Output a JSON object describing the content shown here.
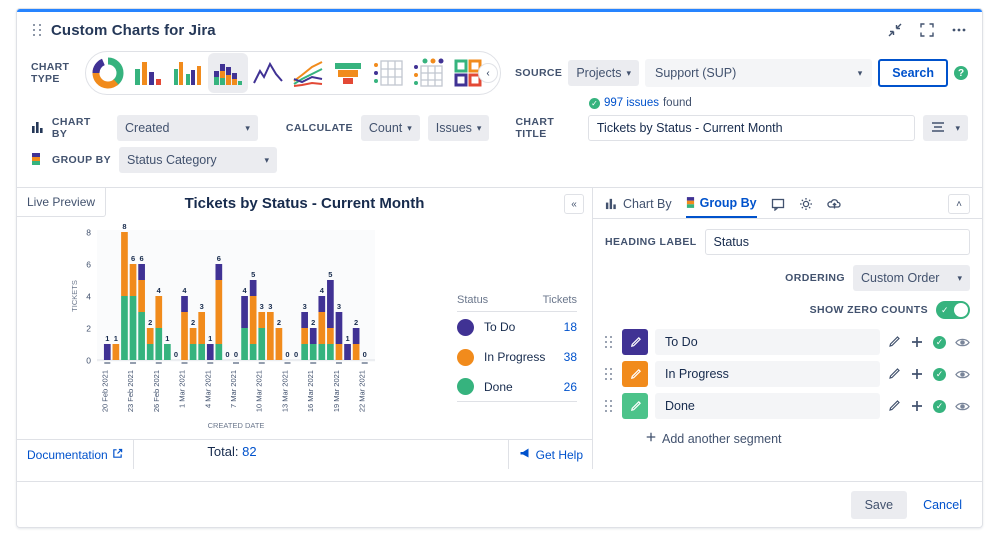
{
  "window": {
    "title": "Custom Charts for Jira",
    "title_actions": [
      {
        "name": "collapse-icon",
        "label": "collapse"
      },
      {
        "name": "fullscreen-icon",
        "label": "fullscreen"
      },
      {
        "name": "more-options-icon",
        "label": "…"
      }
    ]
  },
  "chart_type": {
    "label_line1": "CHART",
    "label_line2": "TYPE",
    "items": [
      {
        "name": "donut-chart-type",
        "selected": false
      },
      {
        "name": "bar-chart-type",
        "selected": false
      },
      {
        "name": "grouped-bar-chart-type",
        "selected": false
      },
      {
        "name": "stacked-bar-chart-type",
        "selected": true
      },
      {
        "name": "area-chart-type",
        "selected": false
      },
      {
        "name": "line-chart-type",
        "selected": false
      },
      {
        "name": "funnel-chart-type",
        "selected": false
      },
      {
        "name": "table-chart-type",
        "selected": false
      },
      {
        "name": "bubble-table-chart-type",
        "selected": false
      },
      {
        "name": "tile-chart-type",
        "selected": false
      }
    ],
    "collapse_label": "‹"
  },
  "source": {
    "label": "SOURCE",
    "kind": "Projects",
    "value": "Support (SUP)",
    "search_label": "Search",
    "help_label": "?",
    "issues_count": "997 issues",
    "issues_suffix": "found"
  },
  "config": {
    "chart_by_label": "CHART BY",
    "chart_by_value": "Created",
    "group_by_label": "GROUP BY",
    "group_by_value": "Status Category",
    "calculate_label": "CALCULATE",
    "calculate_value": "Count",
    "calculate_unit": "Issues",
    "chart_title_label": "CHART TITLE",
    "chart_title_value": "Tickets by Status - Current Month"
  },
  "preview": {
    "tab_label": "Live Preview",
    "collapse_label": "«",
    "total_label": "Total:",
    "total_value": "82",
    "documentation_label": "Documentation",
    "get_help_label": "Get Help"
  },
  "chart_data": {
    "type": "bar",
    "title": "Tickets by Status - Current Month",
    "xlabel": "CREATED DATE",
    "ylabel": "TICKETS",
    "ylim": [
      0,
      8
    ],
    "yticks": [
      0,
      2,
      4,
      6,
      8
    ],
    "grid": false,
    "stacked": true,
    "legend_position": "right",
    "tick_labels": [
      "20 Feb 2021",
      "23 Feb 2021",
      "26 Feb 2021",
      "1 Mar 2021",
      "4 Mar 2021",
      "7 Mar 2021",
      "10 Mar 2021",
      "13 Mar 2021",
      "16 Mar 2021",
      "19 Mar 2021",
      "22 Mar 2021"
    ],
    "series": [
      {
        "name": "To Do",
        "color": "#403294",
        "total": 18
      },
      {
        "name": "In Progress",
        "color": "#F18B1C",
        "total": 38
      },
      {
        "name": "Done",
        "color": "#36B37E",
        "total": 26
      }
    ],
    "bars": [
      {
        "total": 1,
        "todo": 1,
        "inprogress": 0,
        "done": 0
      },
      {
        "total": 1,
        "todo": 0,
        "inprogress": 1,
        "done": 0
      },
      {
        "total": 8,
        "todo": 0,
        "inprogress": 4,
        "done": 4
      },
      {
        "total": 6,
        "todo": 0,
        "inprogress": 2,
        "done": 4
      },
      {
        "total": 6,
        "todo": 1,
        "inprogress": 2,
        "done": 3
      },
      {
        "total": 2,
        "todo": 0,
        "inprogress": 1,
        "done": 1
      },
      {
        "total": 4,
        "todo": 0,
        "inprogress": 2,
        "done": 2
      },
      {
        "total": 1,
        "todo": 0,
        "inprogress": 0,
        "done": 1
      },
      {
        "total": 0,
        "todo": 0,
        "inprogress": 0,
        "done": 0
      },
      {
        "total": 4,
        "todo": 1,
        "inprogress": 3,
        "done": 0
      },
      {
        "total": 2,
        "todo": 0,
        "inprogress": 1,
        "done": 1
      },
      {
        "total": 3,
        "todo": 0,
        "inprogress": 2,
        "done": 1
      },
      {
        "total": 1,
        "todo": 1,
        "inprogress": 0,
        "done": 0
      },
      {
        "total": 6,
        "todo": 1,
        "inprogress": 4,
        "done": 1
      },
      {
        "total": 0,
        "todo": 0,
        "inprogress": 0,
        "done": 0
      },
      {
        "total": 0,
        "todo": 0,
        "inprogress": 0,
        "done": 0
      },
      {
        "total": 4,
        "todo": 2,
        "inprogress": 0,
        "done": 2
      },
      {
        "total": 5,
        "todo": 1,
        "inprogress": 3,
        "done": 1
      },
      {
        "total": 3,
        "todo": 0,
        "inprogress": 1,
        "done": 2
      },
      {
        "total": 3,
        "todo": 0,
        "inprogress": 3,
        "done": 0
      },
      {
        "total": 2,
        "todo": 0,
        "inprogress": 2,
        "done": 0
      },
      {
        "total": 0,
        "todo": 0,
        "inprogress": 0,
        "done": 0
      },
      {
        "total": 0,
        "todo": 0,
        "inprogress": 0,
        "done": 0
      },
      {
        "total": 3,
        "todo": 1,
        "inprogress": 1,
        "done": 1
      },
      {
        "total": 2,
        "todo": 1,
        "inprogress": 0,
        "done": 1
      },
      {
        "total": 4,
        "todo": 1,
        "inprogress": 2,
        "done": 1
      },
      {
        "total": 5,
        "todo": 3,
        "inprogress": 1,
        "done": 1
      },
      {
        "total": 3,
        "todo": 2,
        "inprogress": 1,
        "done": 0
      },
      {
        "total": 1,
        "todo": 1,
        "inprogress": 0,
        "done": 0
      },
      {
        "total": 2,
        "todo": 1,
        "inprogress": 1,
        "done": 0
      },
      {
        "total": 0,
        "todo": 0,
        "inprogress": 0,
        "done": 0
      }
    ]
  },
  "legend": {
    "col_status": "Status",
    "col_tickets": "Tickets",
    "rows": [
      {
        "name": "To Do",
        "value": "18",
        "color": "#403294"
      },
      {
        "name": "In Progress",
        "value": "38",
        "color": "#F18B1C"
      },
      {
        "name": "Done",
        "value": "26",
        "color": "#36B37E"
      }
    ]
  },
  "right_panel": {
    "tabs": [
      {
        "label": "Chart By",
        "icon": "bar-chart-icon",
        "active": false
      },
      {
        "label": "Group By",
        "icon": "stacked-color-icon",
        "active": true
      },
      {
        "label": "",
        "icon": "comment-icon",
        "active": false
      },
      {
        "label": "",
        "icon": "gear-icon",
        "active": false
      },
      {
        "label": "",
        "icon": "cloud-upload-icon",
        "active": false
      }
    ],
    "expand_label": "˄",
    "heading_label": "HEADING LABEL",
    "heading_value": "Status",
    "ordering_label": "ORDERING",
    "ordering_value": "Custom Order",
    "show_zero_counts_label": "SHOW ZERO COUNTS",
    "show_zero_counts_on": true,
    "segments": [
      {
        "name": "To Do",
        "color": "#403294"
      },
      {
        "name": "In Progress",
        "color": "#F18B1C"
      },
      {
        "name": "Done",
        "color": "#36B37E"
      }
    ],
    "add_segment_label": "Add another segment"
  },
  "footer": {
    "save_label": "Save",
    "cancel_label": "Cancel"
  }
}
